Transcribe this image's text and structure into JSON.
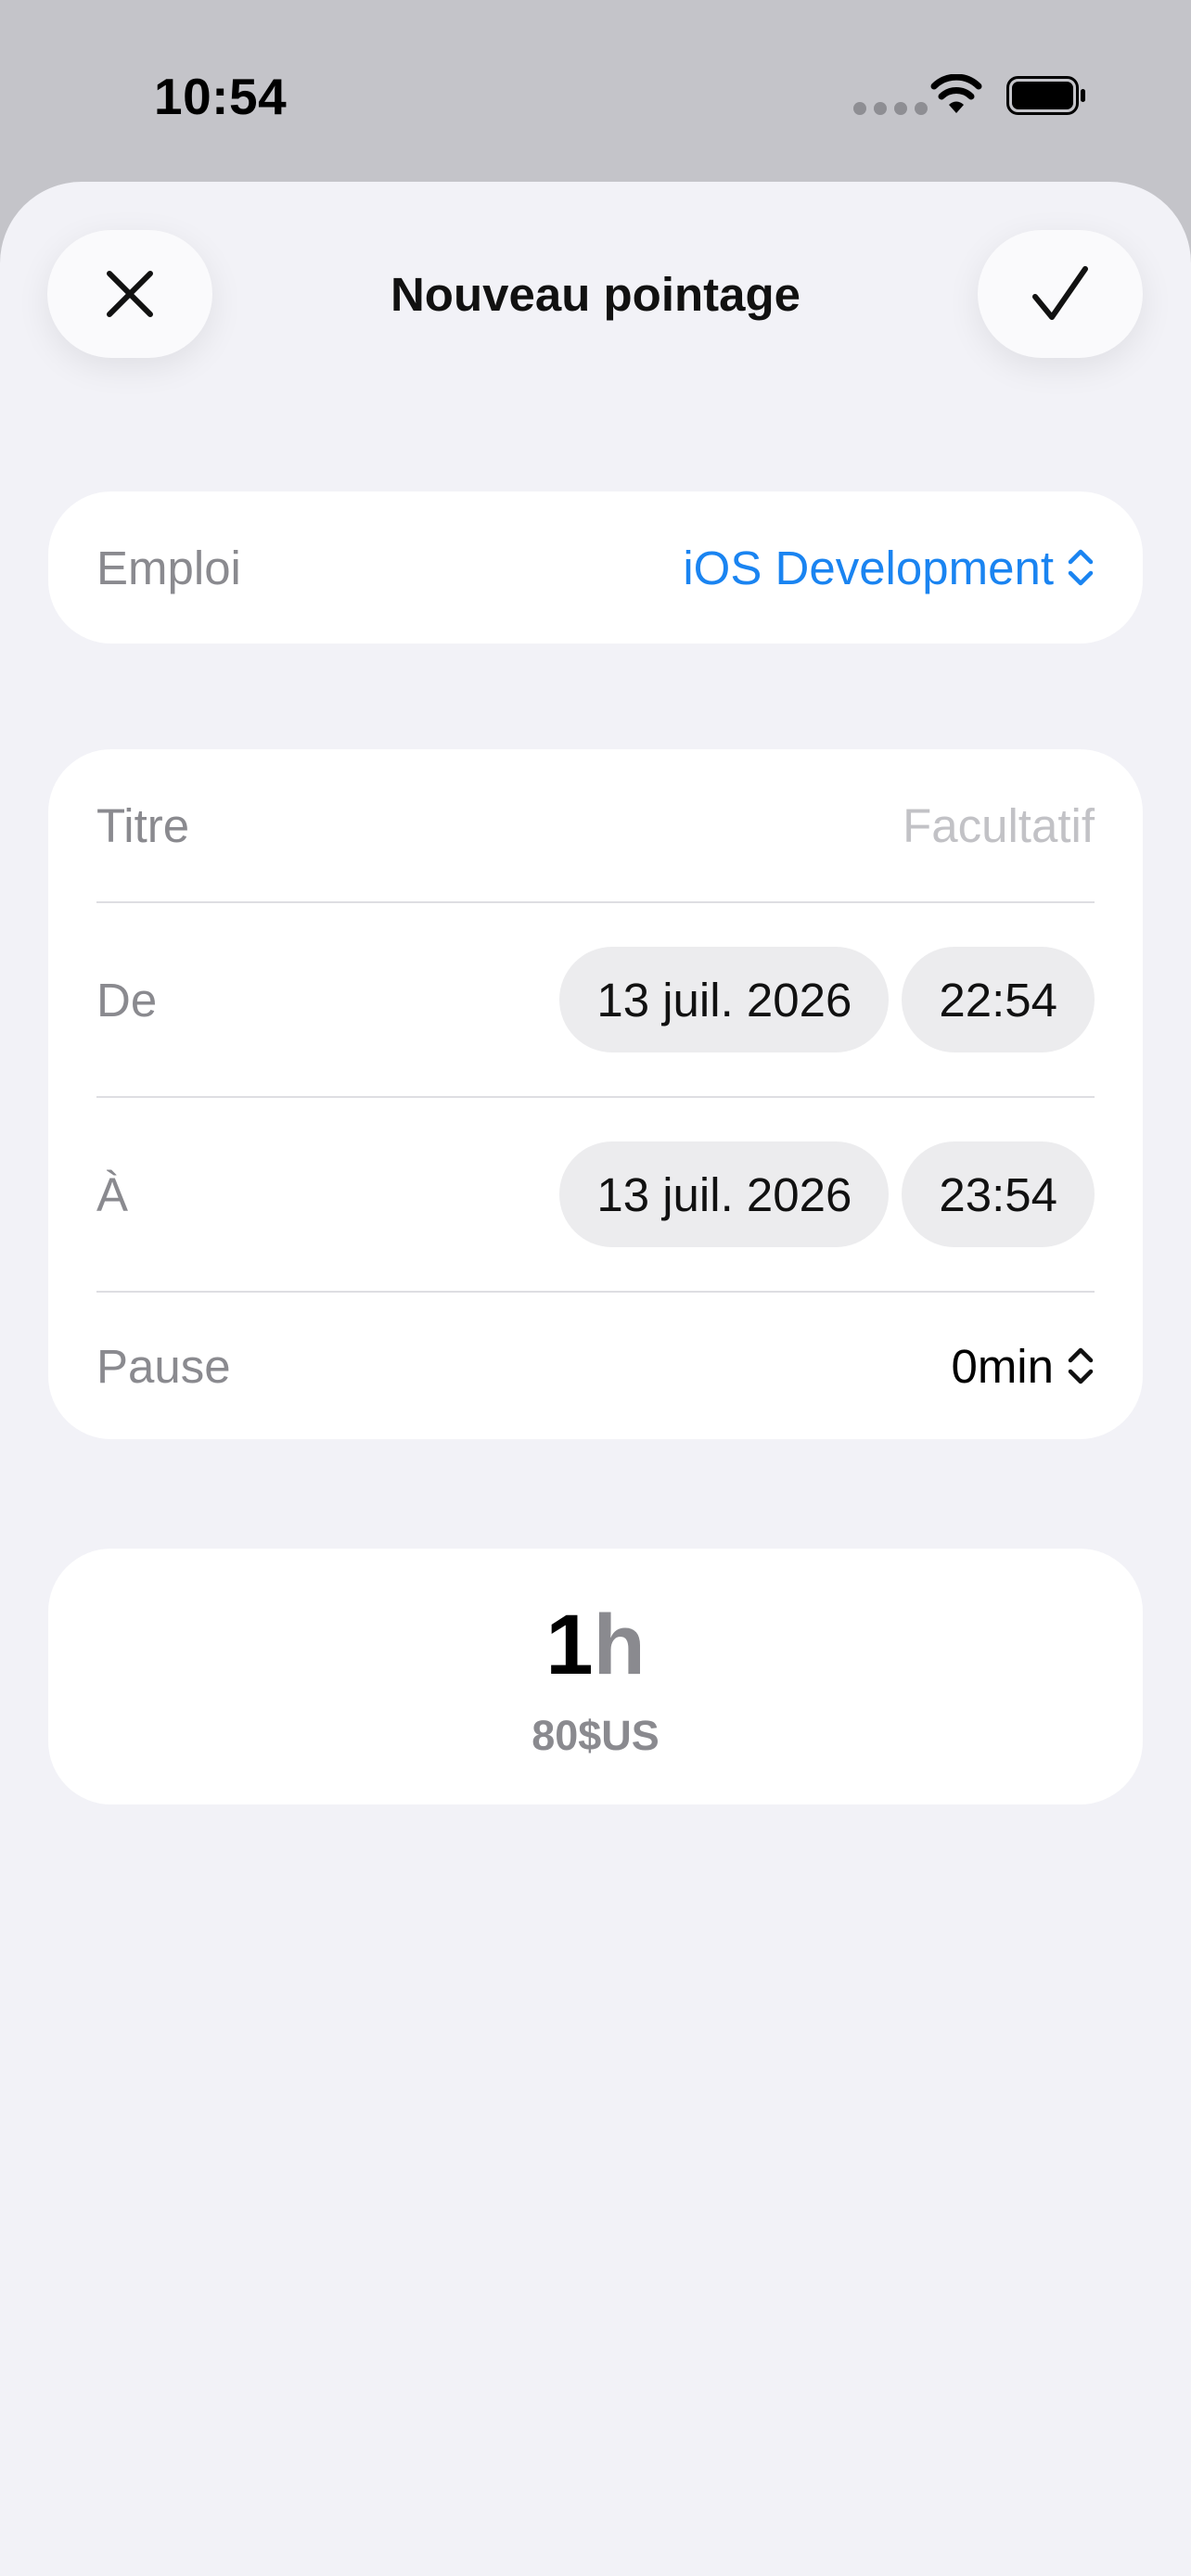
{
  "status_bar": {
    "time": "10:54"
  },
  "header": {
    "title": "Nouveau pointage"
  },
  "job": {
    "label": "Emploi",
    "value": "iOS Development"
  },
  "form": {
    "title_label": "Titre",
    "title_placeholder": "Facultatif",
    "from_label": "De",
    "from_date": "13 juil. 2026",
    "from_time": "22:54",
    "to_label": "À",
    "to_date": "13 juil. 2026",
    "to_time": "23:54",
    "pause_label": "Pause",
    "pause_value": "0min"
  },
  "summary": {
    "hours": "1",
    "unit": "h",
    "pay": "80$US"
  },
  "colors": {
    "accent": "#1a84f1",
    "background": "#f2f2f7",
    "card": "#ffffff"
  },
  "icons": [
    "close-icon",
    "checkmark-icon",
    "chevron-updown-icon",
    "wifi-icon",
    "battery-icon",
    "signal-icon"
  ]
}
